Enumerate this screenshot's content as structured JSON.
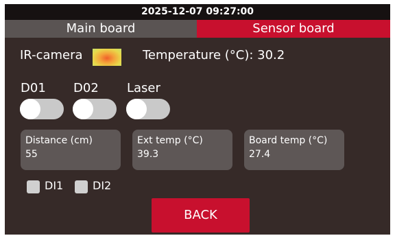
{
  "status": {
    "datetime": "2025-12-07 09:27:00"
  },
  "tabs": [
    {
      "label": "Main board",
      "active": false
    },
    {
      "label": "Sensor board",
      "active": true
    }
  ],
  "ir": {
    "label": "IR-camera",
    "temperature_label": "Temperature (°C): 30.2"
  },
  "toggles": [
    {
      "label": "D01",
      "on": false
    },
    {
      "label": "D02",
      "on": false
    },
    {
      "label": "Laser",
      "on": false
    }
  ],
  "cards": [
    {
      "title": "Distance (cm)",
      "value": "55"
    },
    {
      "title": "Ext temp (°C)",
      "value": "39.3"
    },
    {
      "title": "Board temp (°C)",
      "value": "27.4"
    }
  ],
  "inputs": [
    {
      "label": "DI1",
      "checked": false
    },
    {
      "label": "DI2",
      "checked": false
    }
  ],
  "back_button": {
    "label": "BACK"
  },
  "colors": {
    "background": "#362a28",
    "accent": "#c8102e",
    "card": "#5e5756",
    "tab_inactive": "#5a5453"
  }
}
